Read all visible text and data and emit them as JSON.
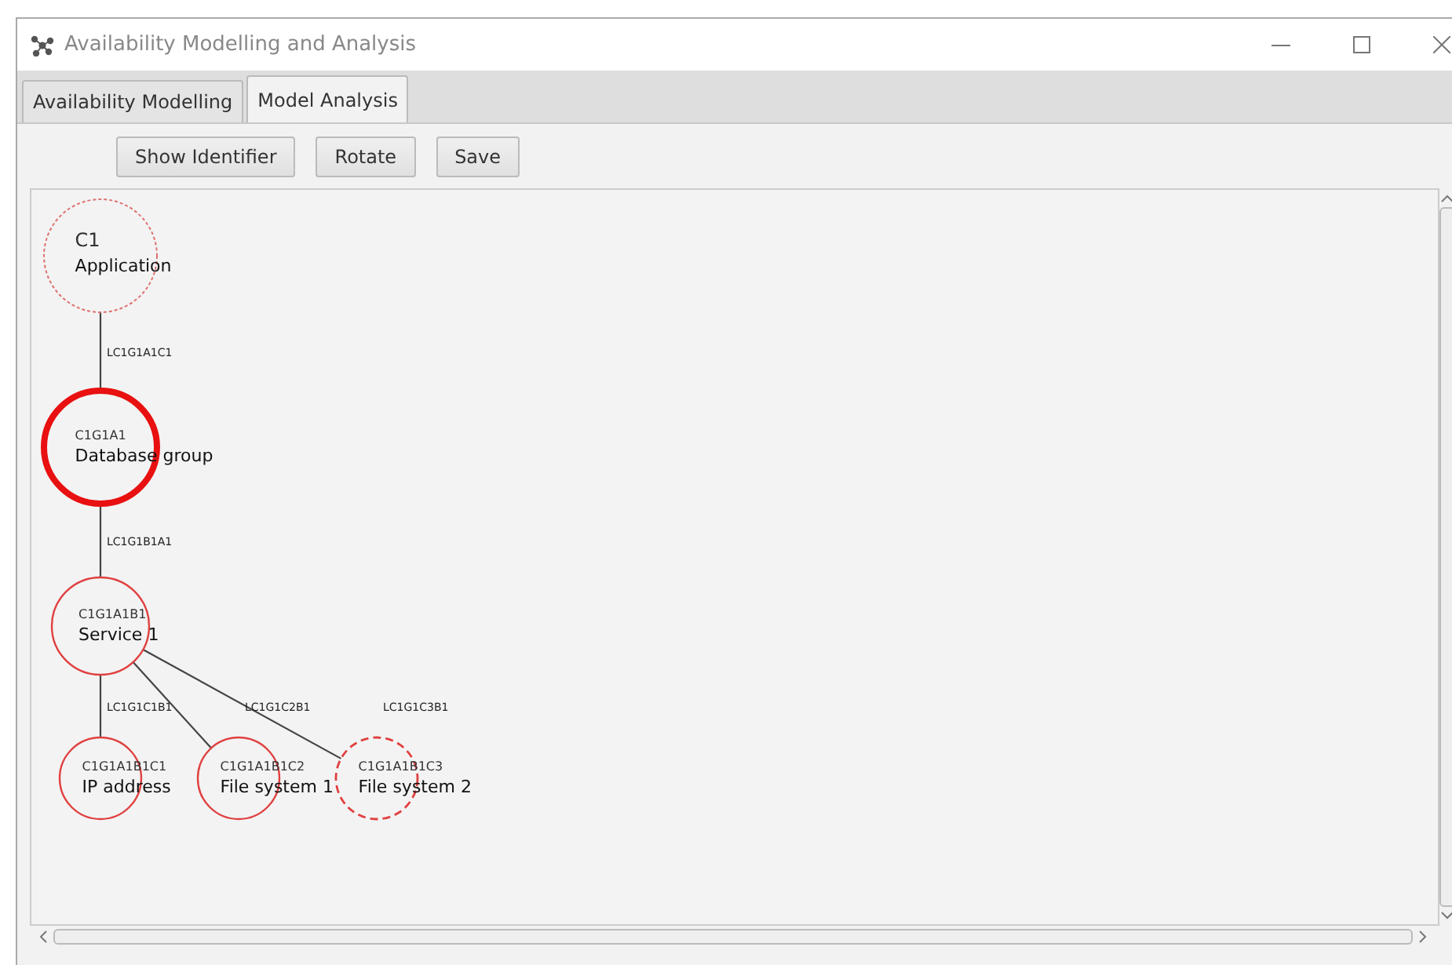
{
  "window": {
    "title": "Availability Modelling and Analysis"
  },
  "tabs": [
    {
      "label": "Availability Modelling",
      "selected": false
    },
    {
      "label": "Model Analysis",
      "selected": true
    }
  ],
  "toolbar": {
    "buttons": [
      "Show Identifier",
      "Rotate",
      "Save"
    ]
  },
  "model": {
    "root": {
      "id": "C1",
      "name": "Application",
      "kind": "dotted",
      "children": [
        {
          "id": "C1G1A1",
          "name": "Database group",
          "kind": "bold",
          "link": "LC1G1A1C1",
          "children": [
            {
              "id": "C1G1A1B1",
              "name": "Service 1",
              "kind": "solid",
              "link": "LC1G1B1A1",
              "children": [
                {
                  "id": "C1G1A1B1C1",
                  "name": "IP address",
                  "kind": "solid",
                  "link": "LC1G1C1B1"
                },
                {
                  "id": "C1G1A1B1C2",
                  "name": "File system 1",
                  "kind": "solid",
                  "link": "LC1G1C2B1"
                },
                {
                  "id": "C1G1A1B1C3",
                  "name": "File system 2",
                  "kind": "dashed",
                  "link": "LC1G1C3B1"
                }
              ]
            }
          ]
        }
      ]
    }
  }
}
